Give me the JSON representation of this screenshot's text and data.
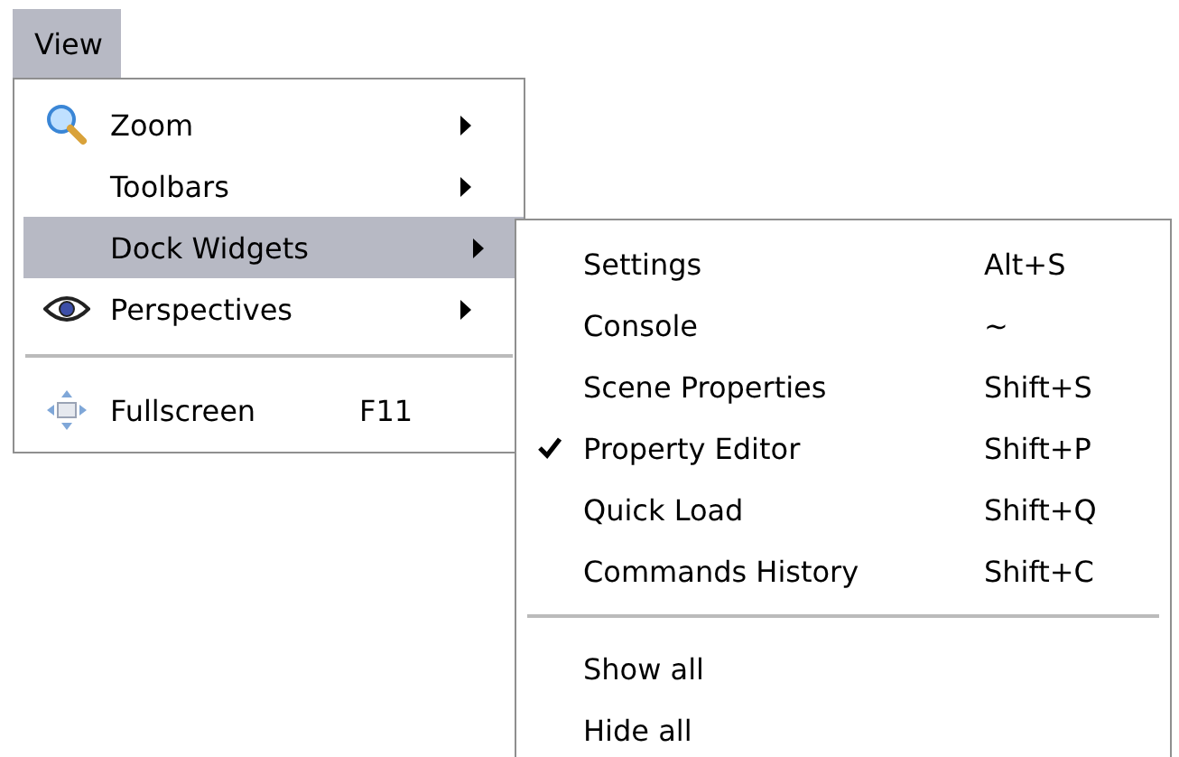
{
  "menubar": [
    {
      "label": "View",
      "selected": true
    }
  ],
  "menu": [
    {
      "kind": "item",
      "label": "Zoom",
      "submenu": true,
      "selected": false
    },
    {
      "kind": "item",
      "label": "Toolbars",
      "submenu": true,
      "selected": false
    },
    {
      "kind": "item",
      "label": "Dock Widgets",
      "submenu": true,
      "selected": true
    },
    {
      "kind": "item",
      "label": "Perspectives",
      "submenu": true,
      "selected": false
    },
    {
      "kind": "separator"
    },
    {
      "kind": "item",
      "label": "Fullscreen",
      "shortcut": "F11",
      "submenu": false,
      "selected": false
    }
  ],
  "submenu": [
    {
      "kind": "item",
      "label": "Settings",
      "shortcut": "Alt+S",
      "checked": false
    },
    {
      "kind": "item",
      "label": "Console",
      "shortcut": "~",
      "checked": false
    },
    {
      "kind": "item",
      "label": "Scene Properties",
      "shortcut": "Shift+S",
      "checked": false
    },
    {
      "kind": "item",
      "label": "Property Editor",
      "shortcut": "Shift+P",
      "checked": true
    },
    {
      "kind": "item",
      "label": "Quick Load",
      "shortcut": "Shift+Q",
      "checked": false
    },
    {
      "kind": "item",
      "label": "Commands History",
      "shortcut": "Shift+C",
      "checked": false
    },
    {
      "kind": "separator"
    },
    {
      "kind": "item",
      "label": "Show all",
      "checked": false
    },
    {
      "kind": "item",
      "label": "Hide all",
      "checked": false
    }
  ]
}
